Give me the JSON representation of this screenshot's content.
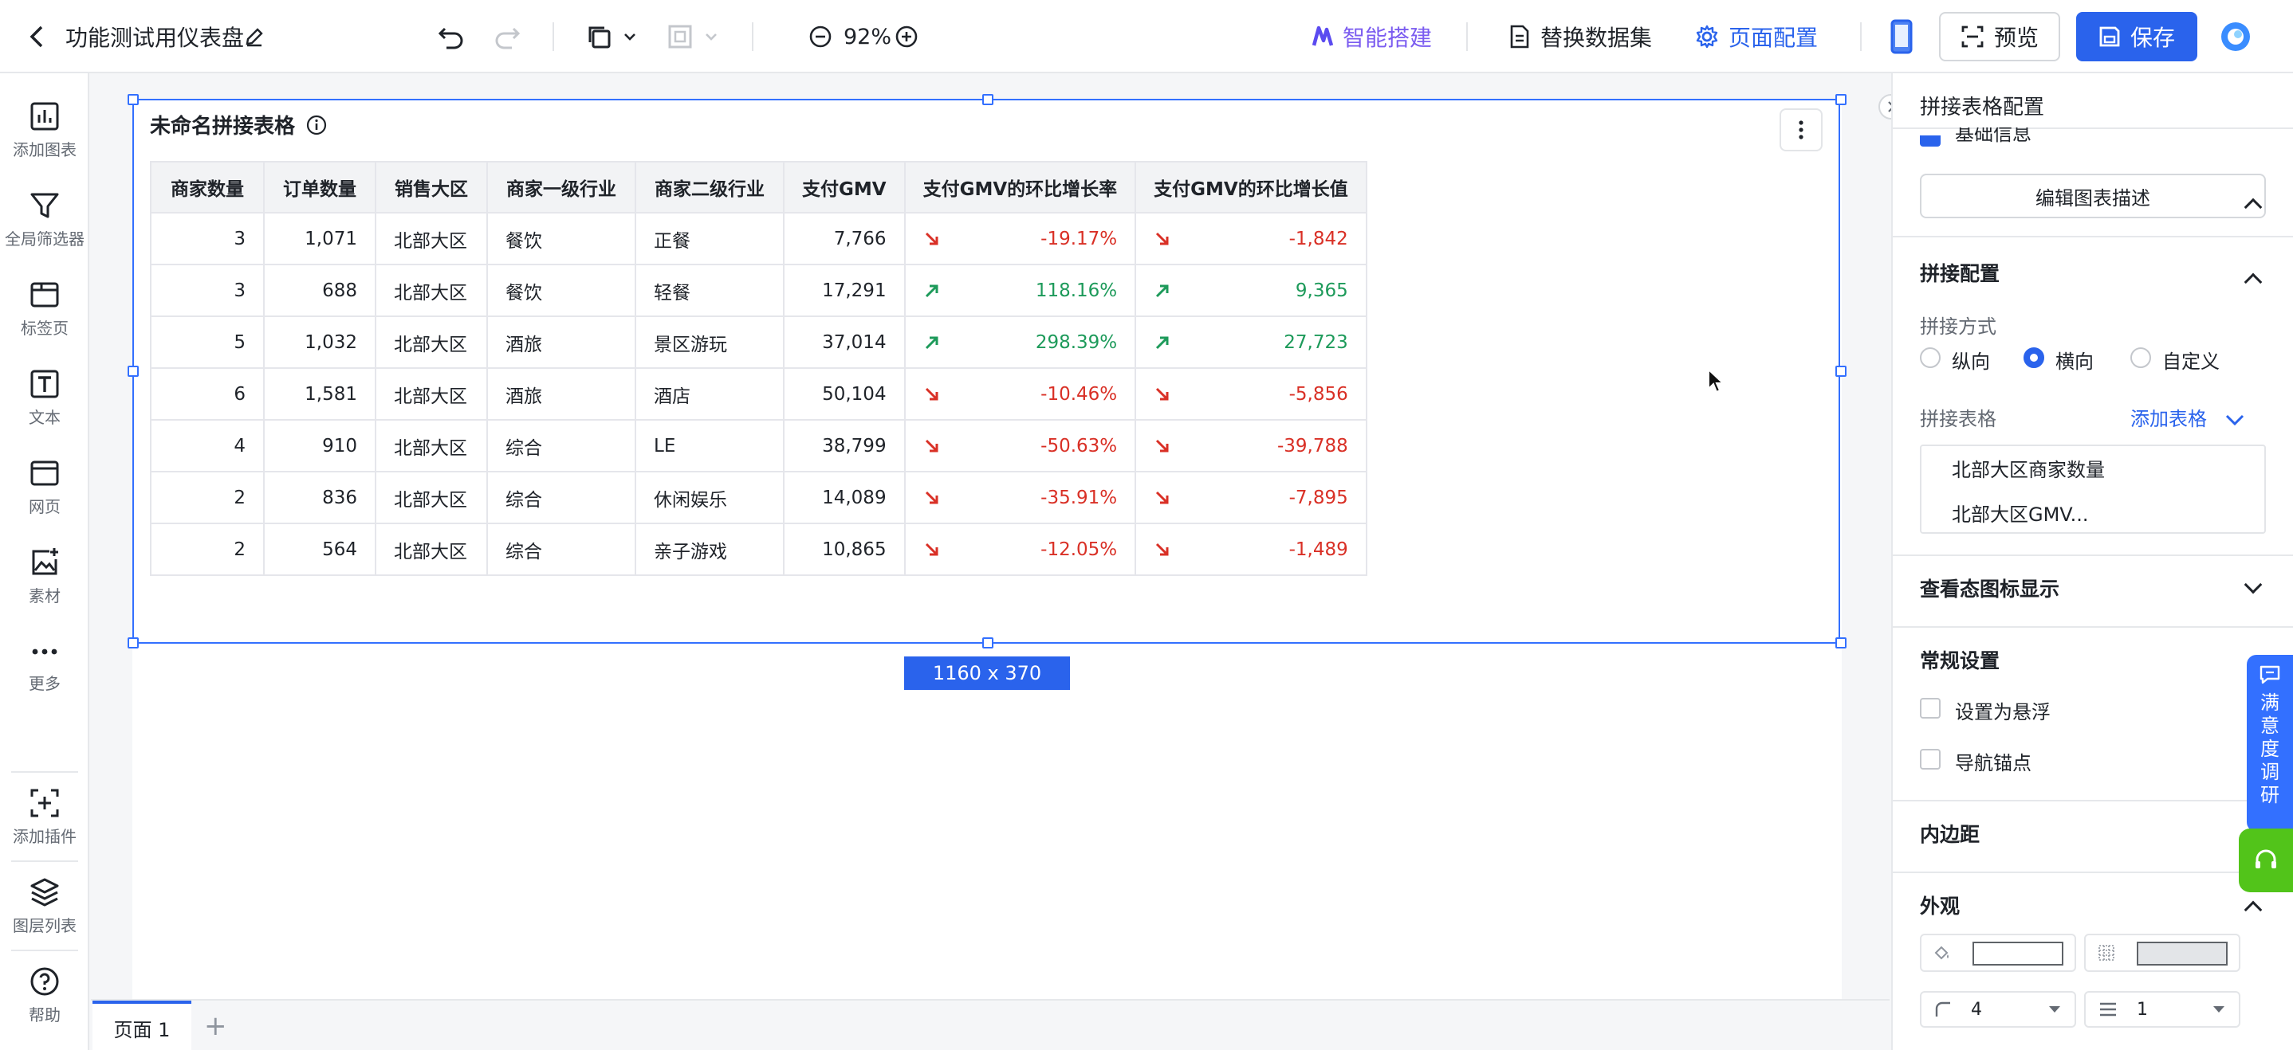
{
  "header": {
    "dashboard_title": "功能测试用仪表盘",
    "zoom": "92%",
    "ai_build": "智能搭建",
    "replace_dataset": "替换数据集",
    "page_config": "页面配置",
    "preview": "预览",
    "save": "保存"
  },
  "sidebar": {
    "items": [
      {
        "label": "添加图表",
        "icon": "chart-icon"
      },
      {
        "label": "全局筛选器",
        "icon": "filter-icon"
      },
      {
        "label": "标签页",
        "icon": "tabs-icon"
      },
      {
        "label": "文本",
        "icon": "text-icon"
      },
      {
        "label": "网页",
        "icon": "webpage-icon"
      },
      {
        "label": "素材",
        "icon": "image-icon"
      },
      {
        "label": "更多",
        "icon": "more-icon"
      },
      {
        "label": "添加插件",
        "icon": "plugin-icon"
      },
      {
        "label": "图层列表",
        "icon": "layers-icon"
      },
      {
        "label": "帮助",
        "icon": "help-icon"
      }
    ]
  },
  "widget": {
    "title": "未命名拼接表格",
    "size_label": "1160 x 370",
    "columns": [
      "商家数量",
      "订单数量",
      "销售大区",
      "商家一级行业",
      "商家二级行业",
      "支付GMV",
      "支付GMV的环比增长率",
      "支付GMV的环比增长值"
    ],
    "rows": [
      {
        "merchants": "3",
        "orders": "1,071",
        "region": "北部大区",
        "industry1": "餐饮",
        "industry2": "正餐",
        "gmv": "7,766",
        "rate": "-19.17%",
        "value": "-1,842",
        "trend": "down"
      },
      {
        "merchants": "3",
        "orders": "688",
        "region": "北部大区",
        "industry1": "餐饮",
        "industry2": "轻餐",
        "gmv": "17,291",
        "rate": "118.16%",
        "value": "9,365",
        "trend": "up"
      },
      {
        "merchants": "5",
        "orders": "1,032",
        "region": "北部大区",
        "industry1": "酒旅",
        "industry2": "景区游玩",
        "gmv": "37,014",
        "rate": "298.39%",
        "value": "27,723",
        "trend": "up"
      },
      {
        "merchants": "6",
        "orders": "1,581",
        "region": "北部大区",
        "industry1": "酒旅",
        "industry2": "酒店",
        "gmv": "50,104",
        "rate": "-10.46%",
        "value": "-5,856",
        "trend": "down"
      },
      {
        "merchants": "4",
        "orders": "910",
        "region": "北部大区",
        "industry1": "综合",
        "industry2": "LE",
        "gmv": "38,799",
        "rate": "-50.63%",
        "value": "-39,788",
        "trend": "down"
      },
      {
        "merchants": "2",
        "orders": "836",
        "region": "北部大区",
        "industry1": "综合",
        "industry2": "休闲娱乐",
        "gmv": "14,089",
        "rate": "-35.91%",
        "value": "-7,895",
        "trend": "down"
      },
      {
        "merchants": "2",
        "orders": "564",
        "region": "北部大区",
        "industry1": "综合",
        "industry2": "亲子游戏",
        "gmv": "10,865",
        "rate": "-12.05%",
        "value": "-1,489",
        "trend": "down"
      }
    ]
  },
  "tabs": {
    "active": "页面 1",
    "add": "+"
  },
  "panel": {
    "title": "拼接表格配置",
    "basic_info": "基础信息",
    "edit_desc": "编辑图表描述",
    "splice_config": "拼接配置",
    "splice_mode_label": "拼接方式",
    "modes": [
      "纵向",
      "横向",
      "自定义"
    ],
    "selected_mode": "横向",
    "splice_tables_label": "拼接表格",
    "add_table": "添加表格",
    "tables": [
      "北部大区商家数量",
      "北部大区GMV..."
    ],
    "view_icon": "查看态图标显示",
    "general": "常规设置",
    "float": "设置为悬浮",
    "anchor": "导航锚点",
    "padding": "内边距",
    "appearance": "外观",
    "radius_value": "4",
    "border_value": "1"
  },
  "survey": {
    "chars": [
      "满",
      "意",
      "度",
      "调",
      "研"
    ]
  },
  "colors": {
    "primary": "#2a63ec",
    "up": "#1d9a5a",
    "down": "#d93026",
    "ai_purple": "#7b5cf0"
  }
}
